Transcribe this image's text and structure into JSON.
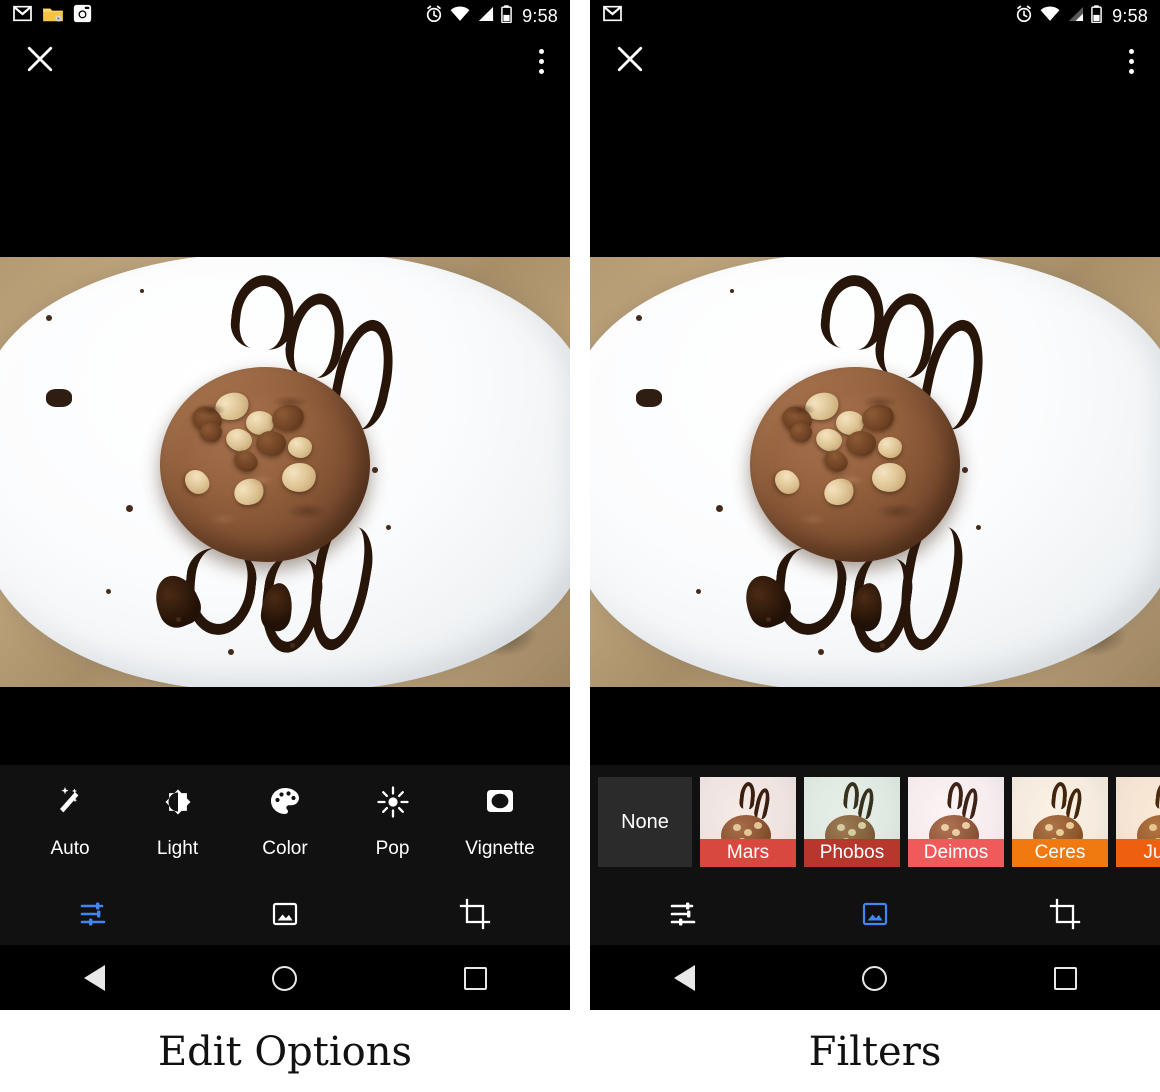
{
  "page": {
    "caption_left": "Edit Options",
    "caption_right": "Filters"
  },
  "status_bar": {
    "time": "9:58",
    "left_icons_panel1": [
      "gmail-icon",
      "folder-icon",
      "instagram-icon"
    ],
    "left_icons_panel2": [
      "gmail-icon"
    ],
    "right_icons": [
      "alarm-icon",
      "wifi-icon",
      "signal-icon",
      "battery-icon"
    ]
  },
  "app_bar": {
    "close_label": "✕",
    "overflow_label": "more-options"
  },
  "edit_panel": {
    "tools": [
      {
        "label": "Auto",
        "icon": "magic-wand-icon"
      },
      {
        "label": "Light",
        "icon": "brightness-icon"
      },
      {
        "label": "Color",
        "icon": "palette-icon"
      },
      {
        "label": "Pop",
        "icon": "sun-pop-icon"
      },
      {
        "label": "Vignette",
        "icon": "vignette-icon"
      }
    ],
    "active_tab": "tune"
  },
  "filters_panel": {
    "none_label": "None",
    "active_tab": "filters",
    "filters": [
      {
        "name": "Mars",
        "color": "#d9483f",
        "tint": "rgba(190,90,60,0.12)"
      },
      {
        "name": "Phobos",
        "color": "#b8372c",
        "tint": "rgba(120,160,130,0.16)"
      },
      {
        "name": "Deimos",
        "color": "#f05a5a",
        "tint": "rgba(255,140,150,0.10)"
      },
      {
        "name": "Ceres",
        "color": "#f07a10",
        "tint": "rgba(235,150,40,0.12)"
      },
      {
        "name": "Juno",
        "color": "#ef5f10",
        "tint": "rgba(240,130,40,0.16)"
      }
    ]
  },
  "bottom_tabs": [
    {
      "name": "tune",
      "icon": "tune-sliders-icon"
    },
    {
      "name": "filters",
      "icon": "photo-filters-icon"
    },
    {
      "name": "crop",
      "icon": "crop-rotate-icon"
    }
  ],
  "nav_bar": {
    "back": "back-triangle-icon",
    "home": "home-circle-icon",
    "recents": "recents-square-icon"
  },
  "colors": {
    "accent_blue": "#4285f4",
    "panel_bg": "#111111",
    "screen_bg": "#000000",
    "page_bg": "#ffffff"
  },
  "photo": {
    "subject": "chocolate-mousse-dessert-with-hazelnuts-on-white-plate"
  }
}
